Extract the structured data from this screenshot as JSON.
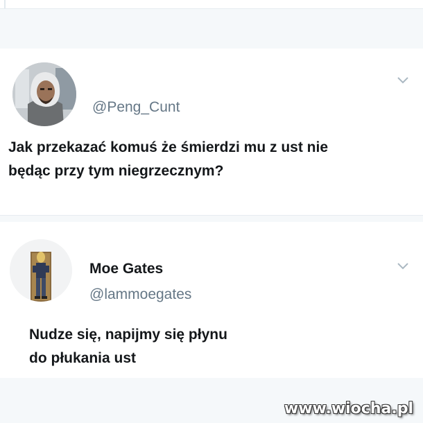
{
  "tweets": [
    {
      "name": "",
      "handle": "@Peng_Cunt",
      "text_lines": [
        "Jak przekazać komuś że śmierdzi mu z ust nie",
        "będąc przy tym niegrzecznym?"
      ],
      "avatar": "hooded-man-photo"
    },
    {
      "name": "Moe Gates",
      "handle": "@lammoegates",
      "text_lines": [
        "Nudze się, napijmy się płynu",
        "do płukania ust"
      ],
      "avatar": "person-standing-photo"
    }
  ],
  "icons": {
    "more": "chevron-down-icon"
  },
  "colors": {
    "background": "#ffffff",
    "separator": "#f5f8fa",
    "text": "#14171a",
    "secondary_text": "#657786",
    "chevron": "#aab8c2"
  },
  "watermark": "www.wiocha.pl"
}
